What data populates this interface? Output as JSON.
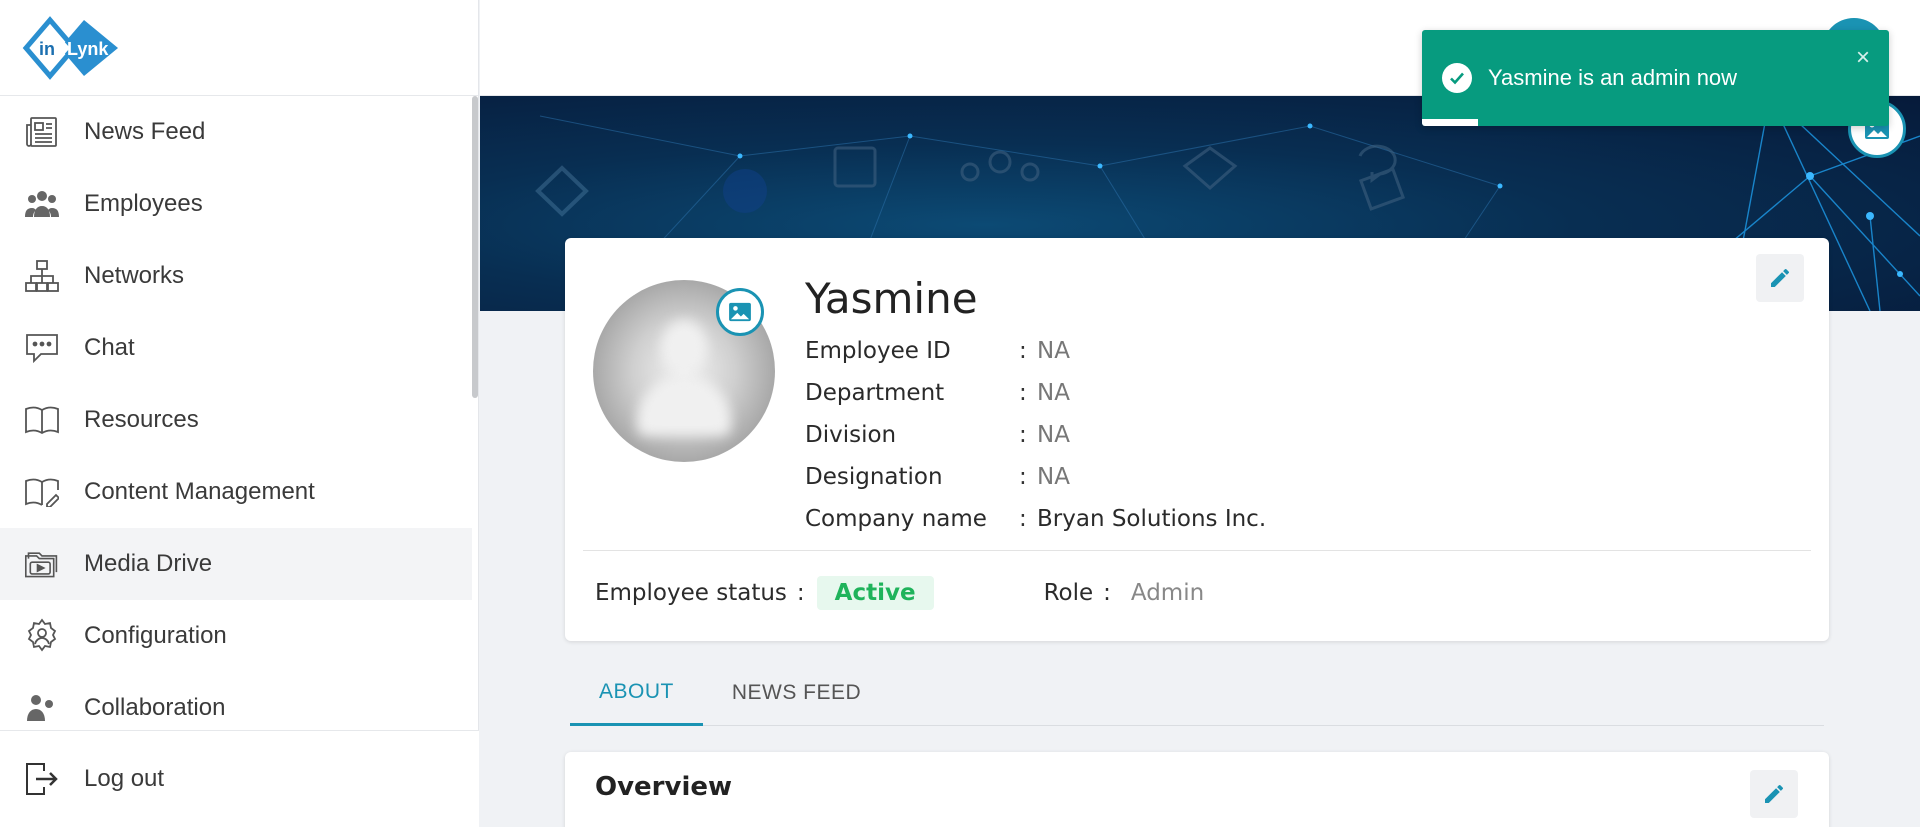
{
  "app": {
    "logo_text_left": "in",
    "logo_text_right": "Lynk"
  },
  "sidebar": {
    "items": [
      {
        "label": "News Feed",
        "icon": "newspaper-icon"
      },
      {
        "label": "Employees",
        "icon": "people-icon"
      },
      {
        "label": "Networks",
        "icon": "network-icon"
      },
      {
        "label": "Chat",
        "icon": "chat-icon"
      },
      {
        "label": "Resources",
        "icon": "book-icon"
      },
      {
        "label": "Content Management",
        "icon": "book-edit-icon"
      },
      {
        "label": "Media Drive",
        "icon": "folder-media-icon",
        "active": true
      },
      {
        "label": "Configuration",
        "icon": "gear-user-icon"
      },
      {
        "label": "Collaboration",
        "icon": "collaboration-icon"
      }
    ],
    "logout_label": "Log out"
  },
  "profile": {
    "name": "Yasmine",
    "fields": [
      {
        "key": "Employee ID",
        "value": "NA"
      },
      {
        "key": "Department",
        "value": "NA"
      },
      {
        "key": "Division",
        "value": "NA"
      },
      {
        "key": "Designation",
        "value": "NA"
      },
      {
        "key": "Company name",
        "value": "Bryan Solutions Inc."
      }
    ],
    "separator": ":",
    "status_label": "Employee status",
    "status_value": "Active",
    "role_label": "Role",
    "role_value": "Admin"
  },
  "tabs": [
    {
      "label": "ABOUT",
      "active": true
    },
    {
      "label": "NEWS FEED",
      "active": false
    }
  ],
  "overview": {
    "title": "Overview"
  },
  "toast": {
    "message": "Yasmine is an admin now",
    "close": "×",
    "progress": 0.12
  },
  "colors": {
    "accent": "#1a93b3",
    "toast_bg": "#079b7f",
    "active_green": "#1fb35b",
    "banner_dark": "#061a3a"
  }
}
